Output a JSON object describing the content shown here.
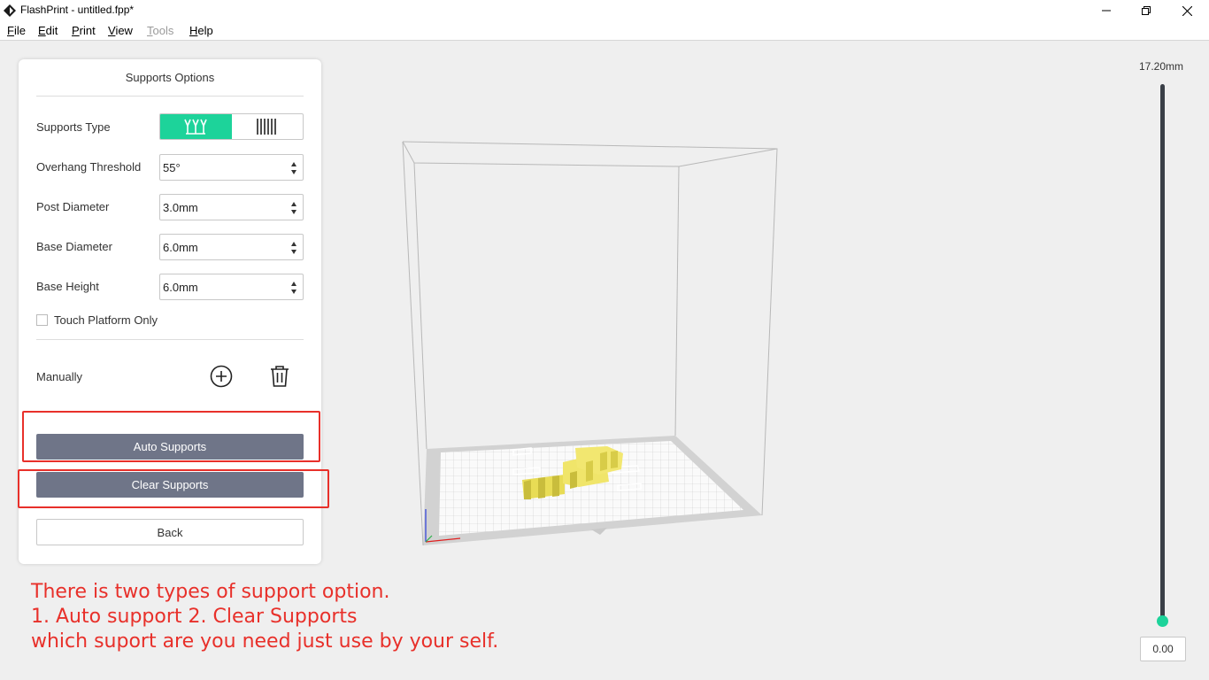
{
  "window": {
    "title": "FlashPrint - untitled.fpp*"
  },
  "menu": {
    "items": [
      {
        "first": "F",
        "rest": "ile",
        "disabled": false
      },
      {
        "first": "E",
        "rest": "dit",
        "disabled": false
      },
      {
        "first": "P",
        "rest": "rint",
        "disabled": false
      },
      {
        "first": "V",
        "rest": "iew",
        "disabled": false
      },
      {
        "first": "T",
        "rest": "ools",
        "disabled": true
      },
      {
        "first": "H",
        "rest": "elp",
        "disabled": false
      }
    ]
  },
  "panel": {
    "title": "Supports Options",
    "supports_type_label": "Supports Type",
    "supports_type_options": [
      "tree-icon",
      "linear-icon"
    ],
    "supports_type_selected": "tree",
    "overhang_label": "Overhang Threshold",
    "overhang_value": "55°",
    "post_diameter_label": "Post Diameter",
    "post_diameter_value": "3.0mm",
    "base_diameter_label": "Base Diameter",
    "base_diameter_value": "6.0mm",
    "base_height_label": "Base Height",
    "base_height_value": "6.0mm",
    "touch_platform_label": "Touch Platform Only",
    "touch_platform_checked": false,
    "manually_label": "Manually",
    "auto_supports_label": "Auto Supports",
    "clear_supports_label": "Clear Supports",
    "back_label": "Back"
  },
  "annotation": {
    "line1": "There is two types of support option.",
    "line2": "1. Auto support 2. Clear Supports",
    "line3": "which suport are you need just use by your self."
  },
  "layer_slider": {
    "max_label": "17.20mm",
    "current_value": "0.00"
  },
  "colors": {
    "accent": "#1dd39a",
    "button_dark": "#6f7588",
    "highlight": "#e8302a",
    "model": "#f0e56a"
  }
}
